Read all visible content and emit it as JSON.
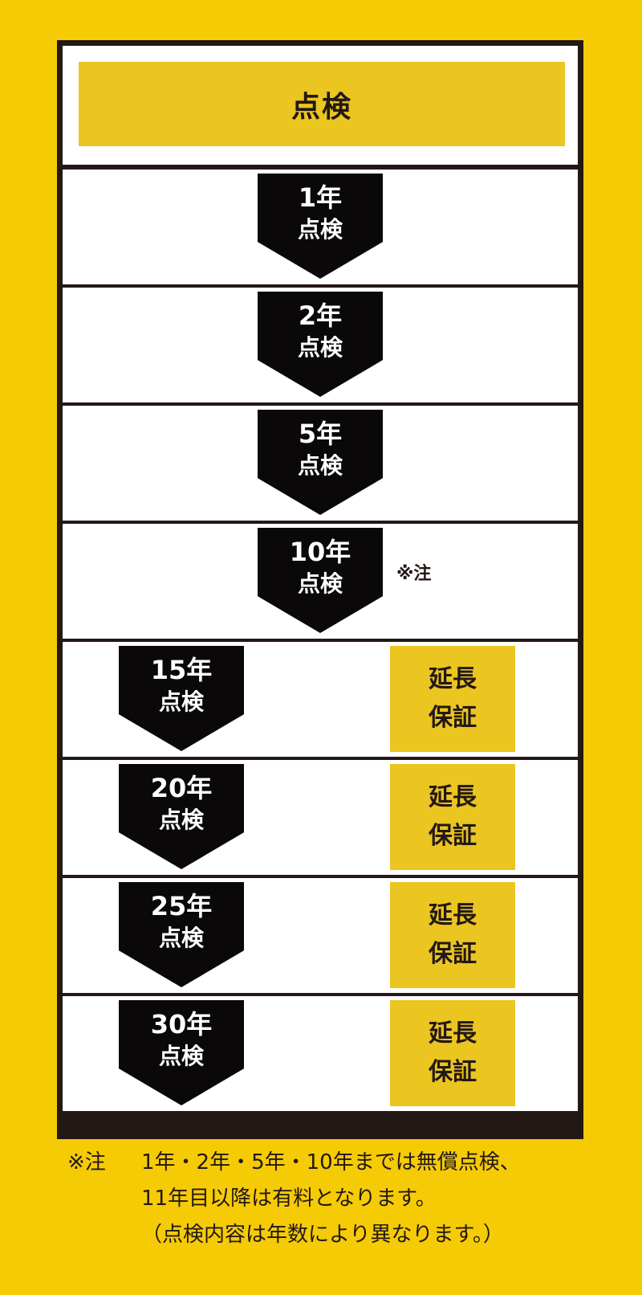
{
  "header": {
    "title": "点検"
  },
  "rows": [
    {
      "year": "1年",
      "label": "点検"
    },
    {
      "year": "2年",
      "label": "点検"
    },
    {
      "year": "5年",
      "label": "点検"
    },
    {
      "year": "10年",
      "label": "点検",
      "note": "※注"
    },
    {
      "year": "15年",
      "label": "点検",
      "ext1": "延長",
      "ext2": "保証"
    },
    {
      "year": "20年",
      "label": "点検",
      "ext1": "延長",
      "ext2": "保証"
    },
    {
      "year": "25年",
      "label": "点検",
      "ext1": "延長",
      "ext2": "保証"
    },
    {
      "year": "30年",
      "label": "点検",
      "ext1": "延長",
      "ext2": "保証"
    }
  ],
  "footnote": {
    "head": "※注",
    "lines": [
      "1年・2年・5年・10年までは無償点検、",
      "11年目以降は有料となります。",
      "（点検内容は年数により異なります。）"
    ]
  },
  "colors": {
    "background": "#f5cb05",
    "frame": "#231815",
    "highlight": "#ebc520",
    "badge": "#0a0808"
  }
}
